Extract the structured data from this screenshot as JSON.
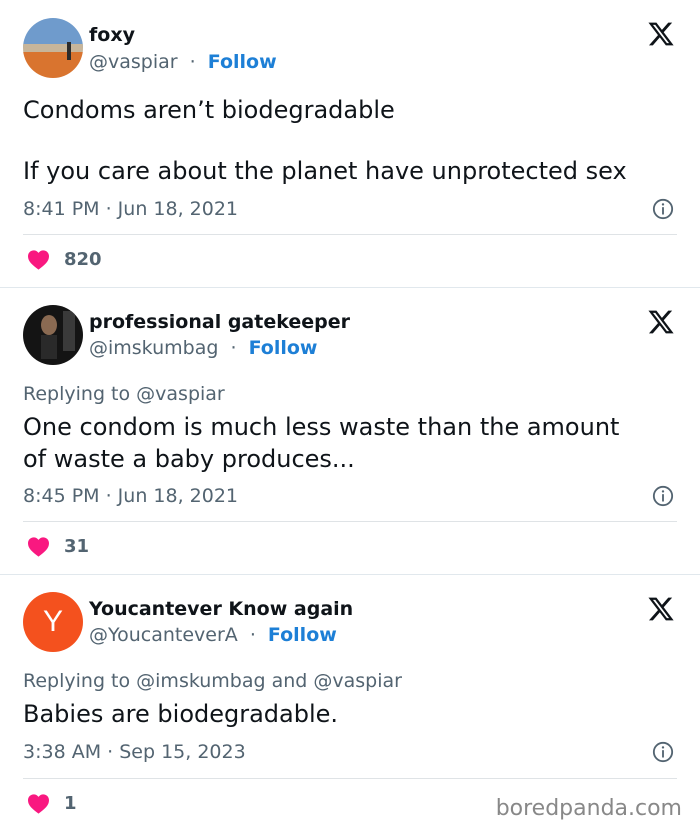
{
  "tweets": [
    {
      "name": "foxy",
      "handle": "@vaspiar",
      "sep": "·",
      "follow": "Follow",
      "reply_to": "",
      "text_lines": [
        "Condoms aren’t biodegradable",
        "If you care about the planet have unprotected sex"
      ],
      "timestamp": "8:41 PM · Jun 18, 2021",
      "likes": "820"
    },
    {
      "name": "professional gatekeeper",
      "handle": "@imskumbag",
      "sep": "·",
      "follow": "Follow",
      "reply_to": "Replying to @vaspiar",
      "text_lines": [
        "One condom is much less waste than the amount",
        "of waste a baby produces..."
      ],
      "timestamp": "8:45 PM · Jun 18, 2021",
      "likes": "31"
    },
    {
      "name": "Youcantever Know again",
      "handle": "@YoucanteverA",
      "sep": "·",
      "follow": "Follow",
      "avatar_letter": "Y",
      "reply_to": "Replying to @imskumbag and @vaspiar",
      "text_lines": [
        "Babies are biodegradable."
      ],
      "timestamp": "3:38 AM · Sep 15, 2023",
      "likes": "1"
    }
  ],
  "colors": {
    "follow": "#1d7fd6",
    "heart": "#f91880",
    "avatar_y": "#f4511e"
  },
  "watermark": "boredpanda.com"
}
